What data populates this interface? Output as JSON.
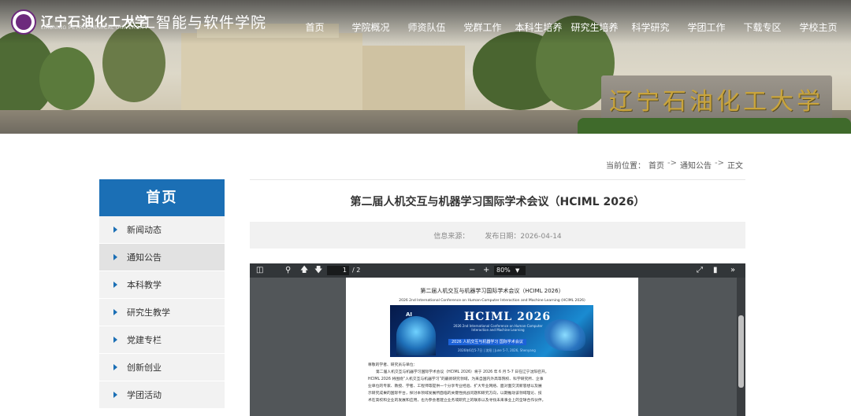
{
  "header": {
    "school_name": "辽宁石油化工大学",
    "school_name_en": "LIAONING PETROCHEMICAL UNIVERSITY",
    "college_name": "人工智能与软件学院",
    "stone_text": "辽宁石油化工大学",
    "nav": [
      "首页",
      "学院概况",
      "师资队伍",
      "党群工作",
      "本科生培养",
      "研究生培养",
      "科学研究",
      "学团工作",
      "下载专区",
      "学校主页"
    ]
  },
  "breadcrumb": {
    "prefix": "当前位置：",
    "items": [
      "首页",
      "通知公告",
      "正文"
    ],
    "separator": "->"
  },
  "sidebar": {
    "title": "首页",
    "items": [
      {
        "label": "新闻动态",
        "active": false
      },
      {
        "label": "通知公告",
        "active": true
      },
      {
        "label": "本科教学",
        "active": false
      },
      {
        "label": "研究生教学",
        "active": false
      },
      {
        "label": "党建专栏",
        "active": false
      },
      {
        "label": "创新创业",
        "active": false
      },
      {
        "label": "学团活动",
        "active": false
      }
    ]
  },
  "article": {
    "title": "第二届人机交互与机器学习国际学术会议（HCIML 2026）",
    "source_label": "信息来源：",
    "date_label": "发布日期：",
    "date": "2026-04-14"
  },
  "pdf_viewer": {
    "current_page": "1",
    "total_pages": "/ 2",
    "zoom": "80%",
    "page": {
      "title": "第二届人机交互与机器学习国际学术会议（HCIML 2026）",
      "subtitle": "2026 2nd International Conference on Human-Computer Interaction and Machine Learning (HCIML 2026)",
      "poster_title": "HCIML 2026",
      "poster_subtitle": "2026 2nd International Conference on Human-Computer Interaction and Machine Learning",
      "poster_banner": "2026 人机交互与机器学习 国际学术会议",
      "poster_date": "2026年6月5-7日 | 沈阳 | June 5-7, 2026, Shenyang",
      "poster_ai": "AI",
      "body": [
        "尊敬的学者、研究员与单位：",
        "第二届人机交互与机器学习国际学术会议（HCIML 2026）将于 2026 年 6 月 5-7 日在辽宁沈阳召开。",
        "HCIML 2026 将围绕“人机交互与机器学习”的最新研究领域，为来自国内外高等院校、科学研究所、企事",
        "业单位的专家、教授、学者、工程师等提供一个分享专业经验、扩大专业网络、面对面交流新思想以及展",
        "示研究成果的国际平台，探讨本领域发展所面临的关键性挑战问题和研究方向，以期推动该领域理论、技",
        "术在高校和企业的发展和应用，也为参会者建立业务或研究上的联系以及寻找未来事业上的全球合作伙伴。"
      ]
    }
  },
  "colors": {
    "sidebar_header": "#1b6fb5",
    "stone_text": "#c9a43d",
    "pdf_toolbar": "#323639",
    "pdf_background": "#525659"
  },
  "icons": [
    "sidebar-toggle-icon",
    "search-icon",
    "arrow-up-icon",
    "arrow-down-icon",
    "zoom-out-icon",
    "zoom-in-icon",
    "fit-page-icon",
    "bookmark-icon",
    "more-tools-icon"
  ]
}
